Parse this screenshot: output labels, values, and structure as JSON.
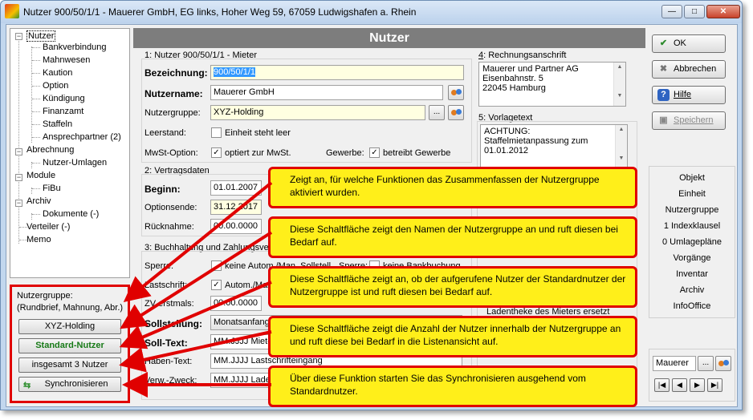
{
  "window": {
    "title": "Nutzer 900/50/1/1 - Mauerer GmbH, EG links, Hoher Weg 59, 67059 Ludwigshafen a. Rhein"
  },
  "tree": {
    "items": [
      {
        "label": "Nutzer",
        "level": 0,
        "selected": true
      },
      {
        "label": "Bankverbindung",
        "level": 1
      },
      {
        "label": "Mahnwesen",
        "level": 1
      },
      {
        "label": "Kaution",
        "level": 1
      },
      {
        "label": "Option",
        "level": 1
      },
      {
        "label": "Kündigung",
        "level": 1
      },
      {
        "label": "Finanzamt",
        "level": 1
      },
      {
        "label": "Staffeln",
        "level": 1
      },
      {
        "label": "Ansprechpartner (2)",
        "level": 1
      },
      {
        "label": "Abrechnung",
        "level": 0
      },
      {
        "label": "Nutzer-Umlagen",
        "level": 1
      },
      {
        "label": "Module",
        "level": 0
      },
      {
        "label": "FiBu",
        "level": 1
      },
      {
        "label": "Archiv",
        "level": 0
      },
      {
        "label": "Dokumente (-)",
        "level": 1
      },
      {
        "label": "Verteiler (-)",
        "level": 0
      },
      {
        "label": "Memo",
        "level": 0
      }
    ]
  },
  "left_panel": {
    "label1": "Nutzergruppe:",
    "label2": "(Rundbrief, Mahnung, Abr.)",
    "group_button": "XYZ-Holding",
    "standard_button": "Standard-Nutzer",
    "count_button": "insgesamt 3 Nutzer",
    "sync_button": "Synchronisieren"
  },
  "main": {
    "header": "Nutzer",
    "section1": {
      "num": "1",
      "title": ": Nutzer 900/50/1/1 - Mieter"
    },
    "bezeichnung_label": "Bezeichnung:",
    "bezeichnung_value": "900/50/1/1",
    "nutzername_label": "Nutzername:",
    "nutzername_value": "Mauerer GmbH",
    "nutzergruppe_label": "Nutzergruppe:",
    "nutzergruppe_value": "XYZ-Holding",
    "leerstand_label": "Leerstand:",
    "leerstand_cb": "Einheit steht leer",
    "mwst_label": "MwSt-Option:",
    "mwst_cb": "optiert zur MwSt.",
    "gewerbe_label": "Gewerbe:",
    "gewerbe_cb": "betreibt Gewerbe",
    "section2": {
      "num": "2",
      "title": ": Vertragsdaten"
    },
    "beginn_label": "Beginn:",
    "beginn_value": "01.01.2007",
    "optionsende_label": "Optionsende:",
    "optionsende_value": "31.12.2017",
    "ruecknahme_label": "Rücknahme:",
    "ruecknahme_value": "00.00.0000",
    "section3": {
      "num": "3",
      "title": ": Buchhaltung und Zahlungsve"
    },
    "sperre_label": "Sperre:",
    "sperre_cb": "keine Autom./Man. Sollstell.",
    "sperre2_label": "Sperre:",
    "sperre2_cb": "keine Bankbuchung",
    "lastschrift_label": "Lastschrift:",
    "lastschrift_cb": "Autom./Man.",
    "zv_label": "ZV erstmals:",
    "zv_value": "00.00.0000",
    "sollstellung_label": "Sollstellung:",
    "sollstellung_value": "Monatsanfang",
    "solltext_label": "Soll-Text:",
    "solltext_value": "MM.JJJJ Miete",
    "habentext_label": "Haben-Text:",
    "habentext_value": "MM.JJJJ Lastschrifteingang",
    "verwzweck_label": "Verw.-Zweck:",
    "verwzweck_value": "MM.JJJJ Laden",
    "section4": {
      "num": "4",
      "title": ": Rechnungsanschrift"
    },
    "address": [
      "Mauerer und Partner AG",
      "Eisenbahnstr. 5",
      "22045 Hamburg"
    ],
    "section5": {
      "num": "5",
      "title": ": Vorlagetext"
    },
    "vorlage": [
      "ACHTUNG:",
      "Staffelmietanpassung zum",
      "01.01.2012"
    ],
    "section6_partial": "Ladentheke des Mieters ersetzt"
  },
  "right": {
    "ok": "OK",
    "abbrechen": "Abbrechen",
    "hilfe": "Hilfe",
    "speichern": "Speichern",
    "info_items": [
      "Objekt",
      "Einheit",
      "Nutzergruppe",
      "1 Indexklausel",
      "0 Umlagepläne",
      "Vorgänge",
      "Inventar",
      "Archiv",
      "InfoOffice"
    ],
    "nav_name": "Mauerer",
    "nav_browse": "..."
  },
  "callouts": [
    "Zeigt an, für welche Funktionen das Zusammenfassen der Nutzergruppe aktiviert wurden.",
    "Diese Schaltfläche zeigt den Namen der Nutzergruppe an und ruft diesen bei Bedarf auf.",
    "Diese Schaltfläche zeigt an, ob der aufgerufene Nutzer der Standardnutzer der Nutzergruppe ist und ruft diesen bei Bedarf auf.",
    "Diese Schaltfläche zeigt die Anzahl der Nutzer innerhalb der Nutzergruppe an und ruft diese bei Bedarf in die Listenansicht auf.",
    "Über diese Funktion starten Sie das Synchronisieren ausgehend vom Standardnutzer."
  ],
  "colors": {
    "accent_red": "#e00000",
    "callout_yellow": "#ffef1a",
    "header_gray": "#7d7d7d",
    "selection_blue": "#3399ff"
  }
}
